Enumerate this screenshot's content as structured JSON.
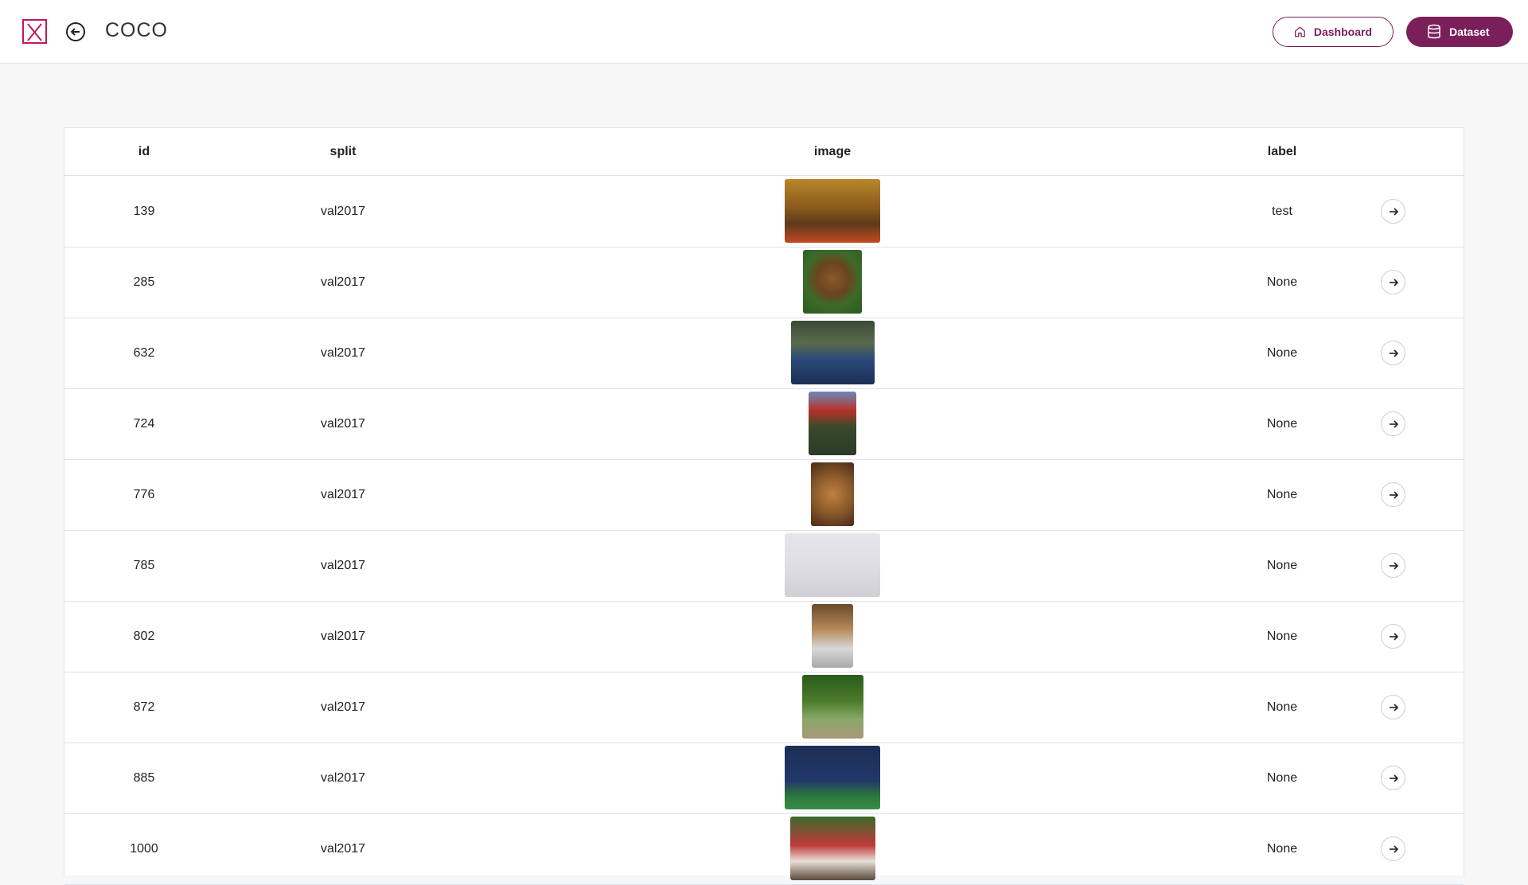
{
  "header": {
    "title": "COCO",
    "logo_icon": "logo-x-icon",
    "back_icon": "arrow-left-circle-icon",
    "dashboard_label": "Dashboard",
    "dashboard_icon": "home-icon",
    "dataset_label": "Dataset",
    "dataset_icon": "database-icon",
    "accent_color": "#7b1f5b",
    "logo_color": "#c2185b"
  },
  "table": {
    "columns": [
      "id",
      "split",
      "image",
      "label"
    ],
    "rows": [
      {
        "id": "139",
        "split": "val2017",
        "label": "test",
        "image": "living-room-photo"
      },
      {
        "id": "285",
        "split": "val2017",
        "label": "None",
        "image": "brown-bear-photo"
      },
      {
        "id": "632",
        "split": "val2017",
        "label": "None",
        "image": "bedroom-photo"
      },
      {
        "id": "724",
        "split": "val2017",
        "label": "None",
        "image": "stop-sign-photo"
      },
      {
        "id": "776",
        "split": "val2017",
        "label": "None",
        "image": "teddy-bears-photo"
      },
      {
        "id": "785",
        "split": "val2017",
        "label": "None",
        "image": "skier-photo"
      },
      {
        "id": "802",
        "split": "val2017",
        "label": "None",
        "image": "kitchen-photo"
      },
      {
        "id": "872",
        "split": "val2017",
        "label": "None",
        "image": "baseball-photo"
      },
      {
        "id": "885",
        "split": "val2017",
        "label": "None",
        "image": "tennis-photo"
      },
      {
        "id": "1000",
        "split": "val2017",
        "label": "None",
        "image": "group-photo"
      }
    ],
    "row_action_icon": "arrow-right-circle-icon"
  }
}
